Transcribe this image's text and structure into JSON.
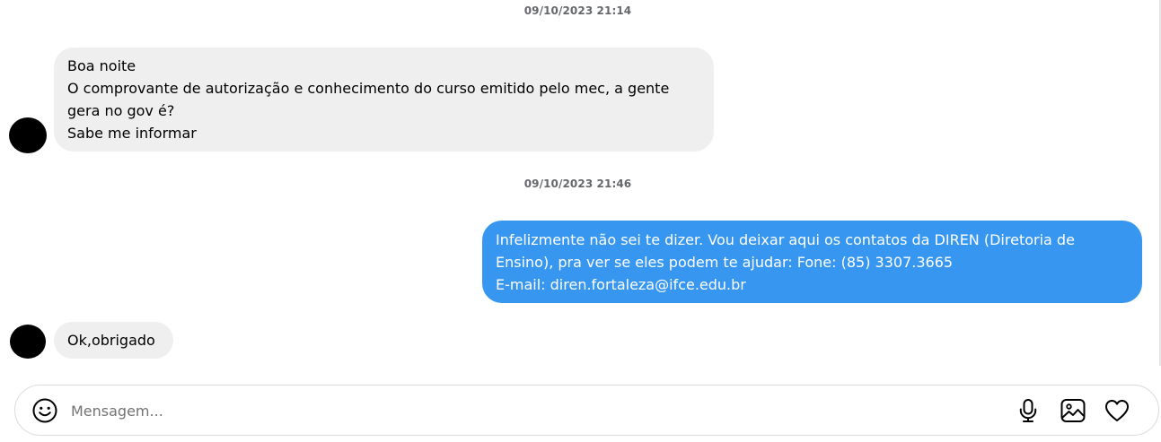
{
  "conversation": {
    "timestamps": [
      "09/10/2023 21:14",
      "09/10/2023 21:46"
    ],
    "messages": [
      {
        "direction": "incoming",
        "lines": [
          "Boa noite",
          "O comprovante de autorização e conhecimento do curso emitido pelo mec, a gente",
          "gera no gov é?",
          "Sabe me informar"
        ]
      },
      {
        "direction": "outgoing",
        "lines": [
          "Infelizmente não sei te dizer. Vou deixar aqui os contatos da DIREN (Diretoria de",
          "Ensino), pra ver se eles podem te ajudar: Fone: (85) 3307.3665",
          "E-mail: diren.fortaleza@ifce.edu.br"
        ]
      },
      {
        "direction": "incoming",
        "lines": [
          "Ok,obrigado"
        ]
      }
    ]
  },
  "composer": {
    "placeholder": "Mensagem...",
    "value": "",
    "icons": {
      "emoji": "emoji-icon",
      "mic": "microphone-icon",
      "image": "image-icon",
      "heart": "heart-icon"
    }
  },
  "colors": {
    "incoming_bubble": "#efefef",
    "outgoing_bubble": "#3797f0",
    "timestamp_text": "#65676b",
    "composer_border": "#dbdbdb"
  }
}
